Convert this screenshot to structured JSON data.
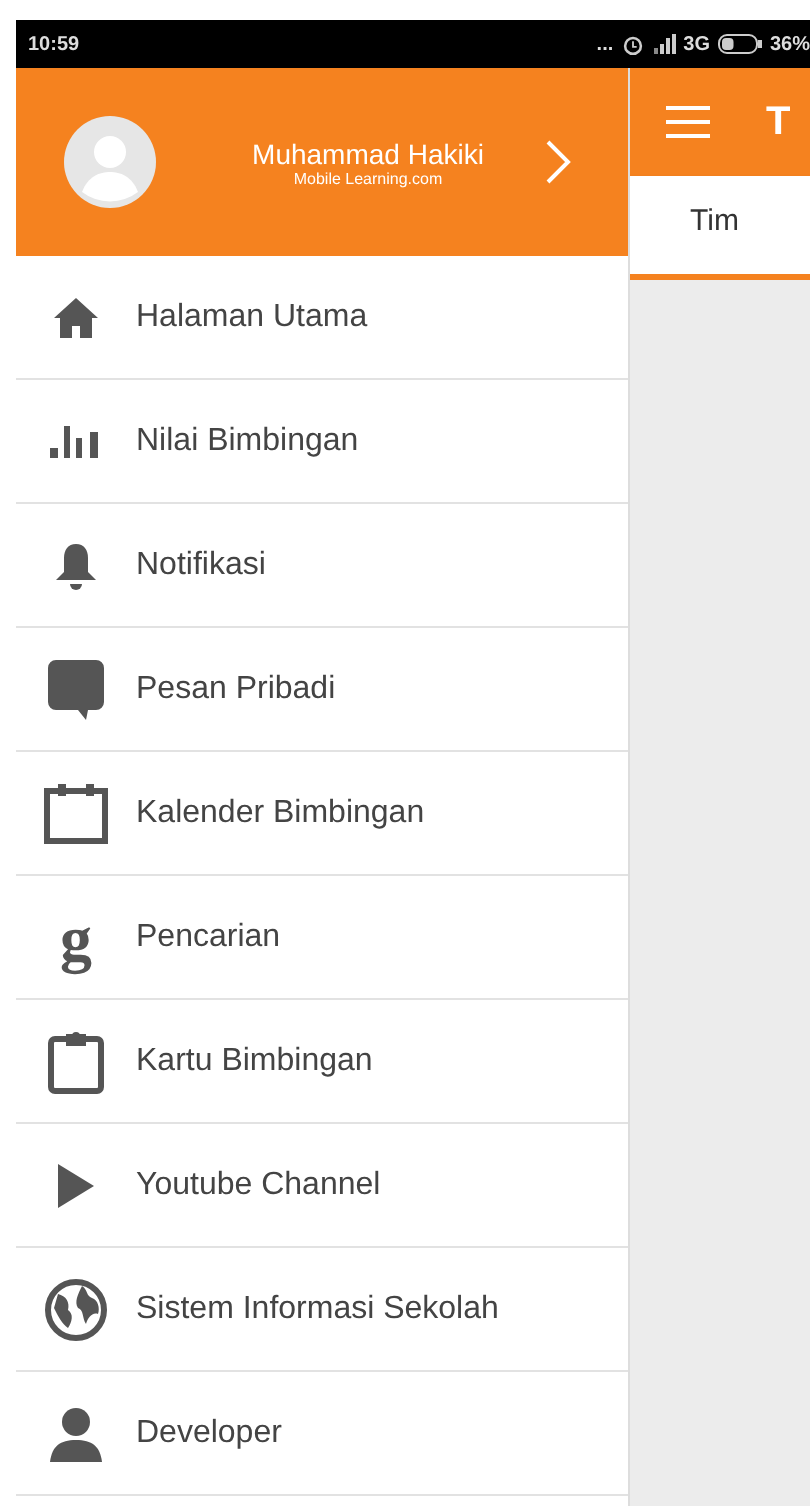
{
  "status_bar": {
    "time": "10:59",
    "dots": "...",
    "network": "3G",
    "battery": {
      "text": "36%",
      "level": 0.36
    }
  },
  "drawer": {
    "user_name": "Muhammad Hakiki",
    "user_subtitle": "Mobile Learning.com",
    "items": [
      {
        "kind": "home",
        "label": "Halaman Utama"
      },
      {
        "kind": "bars",
        "label": "Nilai Bimbingan"
      },
      {
        "kind": "bell",
        "label": "Notifikasi"
      },
      {
        "kind": "chat",
        "label": "Pesan Pribadi"
      },
      {
        "kind": "calendar",
        "label": "Kalender Bimbingan"
      },
      {
        "kind": "letter",
        "glyph": "g",
        "label": "Pencarian"
      },
      {
        "kind": "clipboard",
        "label": "Kartu Bimbingan"
      },
      {
        "kind": "play",
        "label": "Youtube Channel"
      },
      {
        "kind": "globe",
        "label": "Sistem Informasi Sekolah"
      },
      {
        "kind": "person",
        "label": "Developer"
      }
    ]
  },
  "app_bar": {
    "title": "T"
  },
  "tabs": [
    {
      "label": "Tim",
      "selected": true
    }
  ]
}
